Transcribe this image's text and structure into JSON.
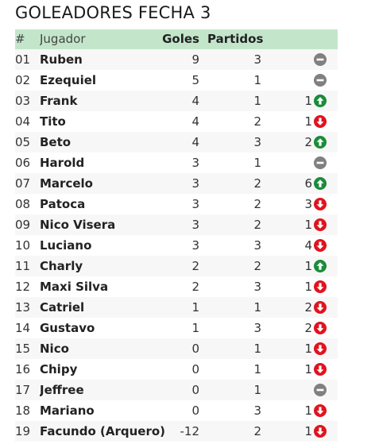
{
  "title": "GOLEADORES FECHA 3",
  "header": {
    "num": "#",
    "player": "Jugador",
    "goals": "Goles",
    "matches": "Partidos"
  },
  "colors": {
    "header_bg": "#c3e6cb",
    "up": "#1a8c3a",
    "down": "#e0141e",
    "same": "#808080"
  },
  "rows": [
    {
      "num": "01",
      "name": "Ruben",
      "goals": "9",
      "matches": "3",
      "change": "",
      "trend": "same"
    },
    {
      "num": "02",
      "name": "Ezequiel",
      "goals": "5",
      "matches": "1",
      "change": "",
      "trend": "same"
    },
    {
      "num": "03",
      "name": "Frank",
      "goals": "4",
      "matches": "1",
      "change": "1",
      "trend": "up"
    },
    {
      "num": "04",
      "name": "Tito",
      "goals": "4",
      "matches": "2",
      "change": "1",
      "trend": "down"
    },
    {
      "num": "05",
      "name": "Beto",
      "goals": "4",
      "matches": "3",
      "change": "2",
      "trend": "up"
    },
    {
      "num": "06",
      "name": "Harold",
      "goals": "3",
      "matches": "1",
      "change": "",
      "trend": "same"
    },
    {
      "num": "07",
      "name": "Marcelo",
      "goals": "3",
      "matches": "2",
      "change": "6",
      "trend": "up"
    },
    {
      "num": "08",
      "name": "Patoca",
      "goals": "3",
      "matches": "2",
      "change": "3",
      "trend": "down"
    },
    {
      "num": "09",
      "name": "Nico Visera",
      "goals": "3",
      "matches": "2",
      "change": "1",
      "trend": "down"
    },
    {
      "num": "10",
      "name": "Luciano",
      "goals": "3",
      "matches": "3",
      "change": "4",
      "trend": "down"
    },
    {
      "num": "11",
      "name": "Charly",
      "goals": "2",
      "matches": "2",
      "change": "1",
      "trend": "up"
    },
    {
      "num": "12",
      "name": "Maxi Silva",
      "goals": "2",
      "matches": "3",
      "change": "1",
      "trend": "down"
    },
    {
      "num": "13",
      "name": "Catriel",
      "goals": "1",
      "matches": "1",
      "change": "2",
      "trend": "down"
    },
    {
      "num": "14",
      "name": "Gustavo",
      "goals": "1",
      "matches": "3",
      "change": "2",
      "trend": "down"
    },
    {
      "num": "15",
      "name": "Nico",
      "goals": "0",
      "matches": "1",
      "change": "1",
      "trend": "down"
    },
    {
      "num": "16",
      "name": "Chipy",
      "goals": "0",
      "matches": "1",
      "change": "1",
      "trend": "down"
    },
    {
      "num": "17",
      "name": "Jeffree",
      "goals": "0",
      "matches": "1",
      "change": "",
      "trend": "same"
    },
    {
      "num": "18",
      "name": "Mariano",
      "goals": "0",
      "matches": "3",
      "change": "1",
      "trend": "down"
    },
    {
      "num": "19",
      "name": "Facundo (Arquero)",
      "goals": "-12",
      "matches": "2",
      "change": "1",
      "trend": "down"
    }
  ]
}
